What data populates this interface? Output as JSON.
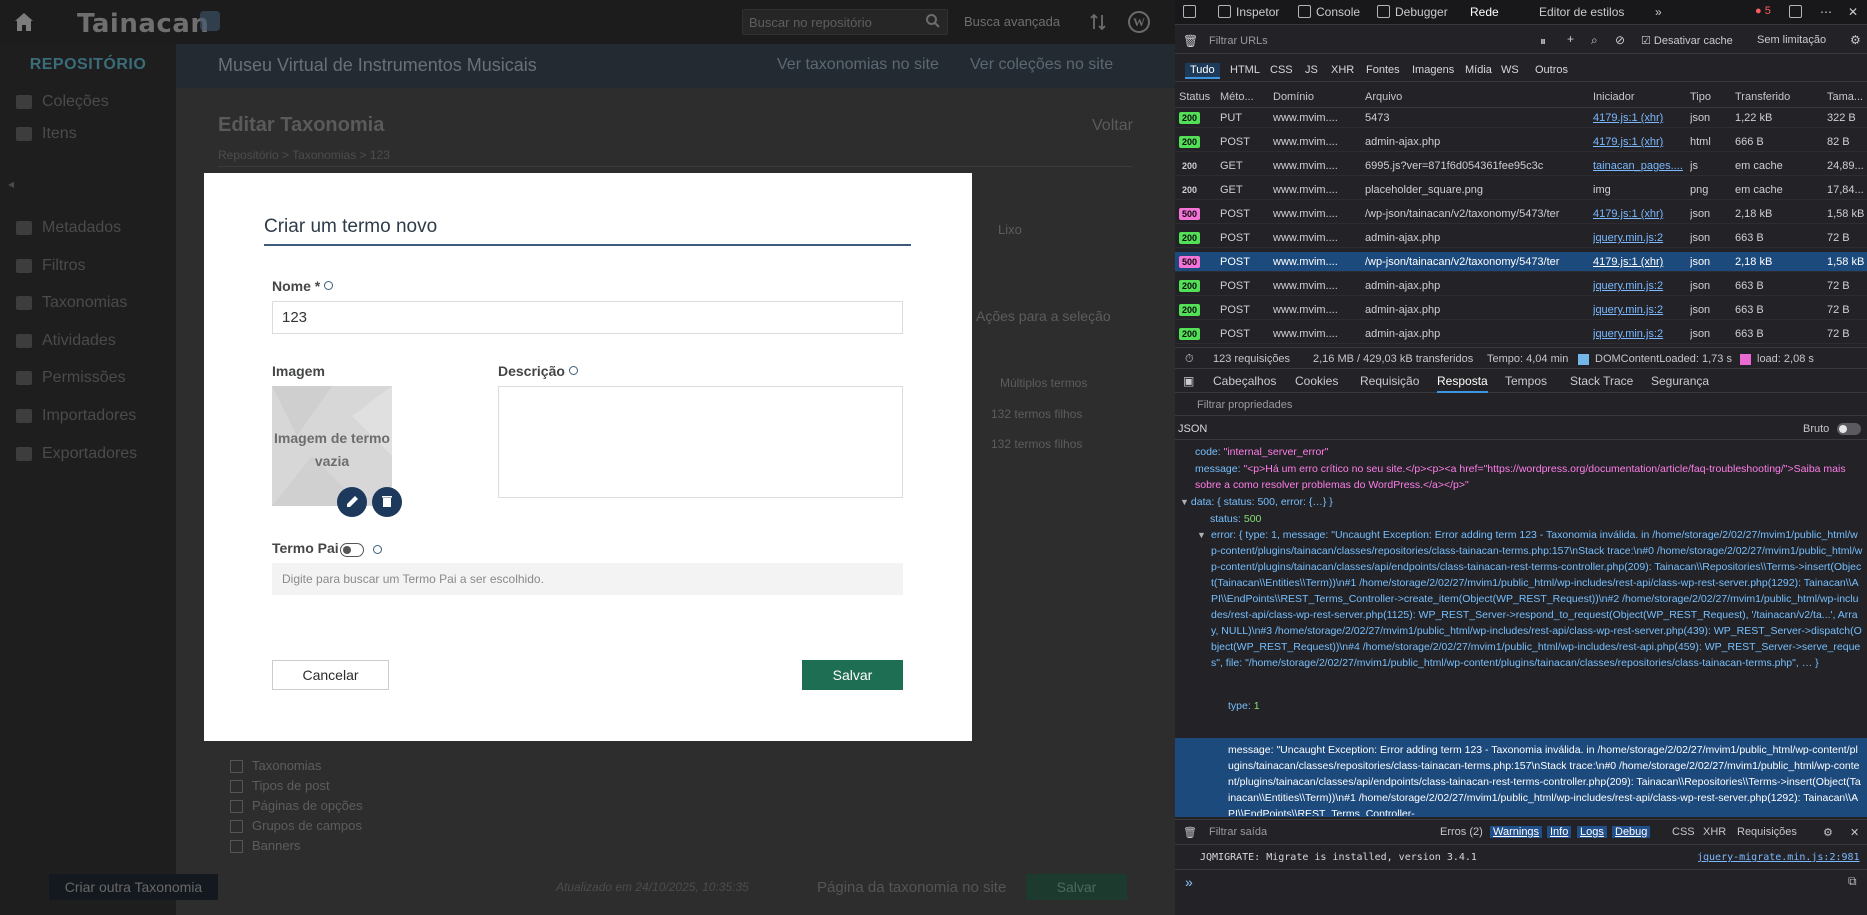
{
  "app": {
    "logo": "Tainacan",
    "search_placeholder": "Buscar no repositório",
    "advanced_search": "Busca avançada",
    "sidebar": {
      "title": "REPOSITÓRIO",
      "items": [
        "Coleções",
        "Itens",
        "Metadados",
        "Filtros",
        "Taxonomias",
        "Atividades",
        "Permissões",
        "Importadores",
        "Exportadores"
      ]
    },
    "header": {
      "museum": "Museu Virtual de Instrumentos Musicais",
      "view_taxonomies": "Ver taxonomias no site",
      "view_collections": "Ver coleções no site"
    },
    "page": {
      "title": "Editar Taxonomia",
      "back": "Voltar",
      "breadcrumb": "Repositório > Taxonomias > 123"
    },
    "background": {
      "trash": "Lixo",
      "bulk_actions": "Ações para a seleção",
      "multiple_terms": "Múltiplos termos",
      "child_terms_1": "132 termos filhos",
      "child_terms_2": "132 termos filhos",
      "checks": [
        "Taxonomias",
        "Tipos de post",
        "Páginas de opções",
        "Grupos de campos",
        "Banners"
      ],
      "create_other": "Criar outra Taxonomia",
      "updated": "Atualizado em 24/10/2025, 10:35:35",
      "taxonomy_page": "Página da taxonomia no site",
      "save": "Salvar"
    }
  },
  "modal": {
    "title": "Criar um termo novo",
    "name_label": "Nome *",
    "name_value": "123",
    "image_label": "Imagem",
    "image_empty": "Imagem de termo vazia",
    "description_label": "Descrição",
    "parent_label": "Termo Pai",
    "parent_placeholder": "Digite para buscar um Termo Pai a ser escolhido.",
    "cancel": "Cancelar",
    "save": "Salvar"
  },
  "devtools": {
    "tabs": [
      "Inspetor",
      "Console",
      "Debugger",
      "Rede",
      "Editor de estilos"
    ],
    "error_count": "5",
    "filter_urls": "Filtrar URLs",
    "disable_cache": "Desativar cache",
    "throttle": "Sem limitação",
    "types": [
      "Tudo",
      "HTML",
      "CSS",
      "JS",
      "XHR",
      "Fontes",
      "Imagens",
      "Mídia",
      "WS",
      "Outros"
    ],
    "columns": [
      "Status",
      "Méto...",
      "Domínio",
      "Arquivo",
      "Iniciador",
      "Tipo",
      "Transferido",
      "Tama..."
    ],
    "rows": [
      {
        "status": "200",
        "cls": "b200",
        "method": "PUT",
        "domain": "www.mvim....",
        "file": "5473",
        "init": "4179.js:1 (xhr)",
        "type": "json",
        "trans": "1,22 kB",
        "size": "322 B"
      },
      {
        "status": "200",
        "cls": "b200",
        "method": "POST",
        "domain": "www.mvim....",
        "file": "admin-ajax.php",
        "init": "4179.js:1 (xhr)",
        "type": "html",
        "trans": "666 B",
        "size": "82 B"
      },
      {
        "status": "200",
        "cls": "bplain",
        "method": "GET",
        "domain": "www.mvim....",
        "file": "6995.js?ver=871f6d054361fee95c3c",
        "init": "tainacan_pages....",
        "type": "js",
        "trans": "em cache",
        "size": "24,89..."
      },
      {
        "status": "200",
        "cls": "bplain",
        "method": "GET",
        "domain": "www.mvim....",
        "file": "placeholder_square.png",
        "init": "img",
        "type": "png",
        "trans": "em cache",
        "size": "17,84..."
      },
      {
        "status": "500",
        "cls": "b500",
        "method": "POST",
        "domain": "www.mvim....",
        "file": "/wp-json/tainacan/v2/taxonomy/5473/ter",
        "init": "4179.js:1 (xhr)",
        "type": "json",
        "trans": "2,18 kB",
        "size": "1,58 kB"
      },
      {
        "status": "200",
        "cls": "b200",
        "method": "POST",
        "domain": "www.mvim....",
        "file": "admin-ajax.php",
        "init": "jquery.min.js:2",
        "type": "json",
        "trans": "663 B",
        "size": "72 B"
      },
      {
        "status": "500",
        "cls": "b500",
        "method": "POST",
        "domain": "www.mvim....",
        "file": "/wp-json/tainacan/v2/taxonomy/5473/ter",
        "init": "4179.js:1 (xhr)",
        "type": "json",
        "trans": "2,18 kB",
        "size": "1,58 kB",
        "selected": true
      },
      {
        "status": "200",
        "cls": "b200",
        "method": "POST",
        "domain": "www.mvim....",
        "file": "admin-ajax.php",
        "init": "jquery.min.js:2",
        "type": "json",
        "trans": "663 B",
        "size": "72 B"
      },
      {
        "status": "200",
        "cls": "b200",
        "method": "POST",
        "domain": "www.mvim....",
        "file": "admin-ajax.php",
        "init": "jquery.min.js:2",
        "type": "json",
        "trans": "663 B",
        "size": "72 B"
      },
      {
        "status": "200",
        "cls": "b200",
        "method": "POST",
        "domain": "www.mvim....",
        "file": "admin-ajax.php",
        "init": "jquery.min.js:2",
        "type": "json",
        "trans": "663 B",
        "size": "72 B"
      }
    ],
    "summary": {
      "requests": "123 requisições",
      "transferred": "2,16 MB / 429,03 kB transferidos",
      "time": "Tempo: 4,04 min",
      "dcl": "DOMContentLoaded: 1,73 s",
      "load": "load: 2,08 s"
    },
    "panel_tabs": [
      "Cabeçalhos",
      "Cookies",
      "Requisição",
      "Resposta",
      "Tempos",
      "Stack Trace",
      "Segurança"
    ],
    "filter_props": "Filtrar propriedades",
    "json_label": "JSON",
    "raw_label": "Bruto",
    "json": {
      "code_key": "code:",
      "code_val": "\"internal_server_error\"",
      "message_key": "message:",
      "message_val": "\"<p>Há um erro crítico no seu site.</p><p><a href=\"https://wordpress.org/documentation/article/faq-troubleshooting/\">Saiba mais sobre a como resolver problemas do WordPress.</a></p>\"",
      "data_line": "data: { status: 500, error: {…} }",
      "status_key": "status:",
      "status_val": "500",
      "error_line": "error: { type: 1, message: \"Uncaught Exception: Error adding term 123 - Taxonomia inválida. in /home/storage/2/02/27/mvim1/public_html/wp-content/plugins/tainacan/classes/repositories/class-tainacan-terms.php:157\\nStack trace:\\n#0 /home/storage/2/02/27/mvim1/public_html/wp-content/plugins/tainacan/classes/api/endpoints/class-tainacan-rest-terms-controller.php(209): Tainacan\\\\Repositories\\\\Terms->insert(Object(Tainacan\\\\Entities\\\\Term))\\n#1 /home/storage/2/02/27/mvim1/public_html/wp-includes/rest-api/class-wp-rest-server.php(1292): Tainacan\\\\API\\\\EndPoints\\\\REST_Terms_Controller->create_item(Object(WP_REST_Request))\\n#2 /home/storage/2/02/27/mvim1/public_html/wp-includes/rest-api/class-wp-rest-server.php(1125): WP_REST_Server->respond_to_request(Object(WP_REST_Request), '/tainacan/v2/ta...', Array, NULL)\\n#3 /home/storage/2/02/27/mvim1/public_html/wp-includes/rest-api/class-wp-rest-server.php(439): WP_REST_Server->dispatch(Object(WP_REST_Request))\\n#4 /home/storage/2/02/27/mvim1/public_html/wp-includes/rest-api.php(459): WP_REST_Server->serve_reques\", file: \"/home/storage/2/02/27/mvim1/public_html/wp-content/plugins/tainacan/classes/repositories/class-tainacan-terms.php\", … }",
      "type_key": "type:",
      "type_val": "1",
      "msg2_key": "message:",
      "msg2_val": "\"Uncaught Exception: Error adding term 123 - Taxonomia inválida. in /home/storage/2/02/27/mvim1/public_html/wp-content/plugins/tainacan/classes/repositories/class-tainacan-terms.php:157\\nStack trace:\\n#0 /home/storage/2/02/27/mvim1/public_html/wp-content/plugins/tainacan/classes/api/endpoints/class-tainacan-rest-terms-controller.php(209): Tainacan\\\\Repositories\\\\Terms->insert(Object(Tainacan\\\\Entities\\\\Term))\\n#1 /home/storage/2/02/27/mvim1/public_html/wp-includes/rest-api/class-wp-rest-server.php(1292): Tainacan\\\\API\\\\EndPoints\\\\REST_Terms_Controller-"
    },
    "console": {
      "filter": "Filtrar saída",
      "errors": "Erros (2)",
      "warnings": "Warnings",
      "info": "Info",
      "logs": "Logs",
      "debug": "Debug",
      "css": "CSS",
      "xhr": "XHR",
      "requests": "Requisições",
      "line": "JQMIGRATE: Migrate is installed, version 3.4.1",
      "source": "jquery-migrate.min.js:2:981"
    }
  }
}
